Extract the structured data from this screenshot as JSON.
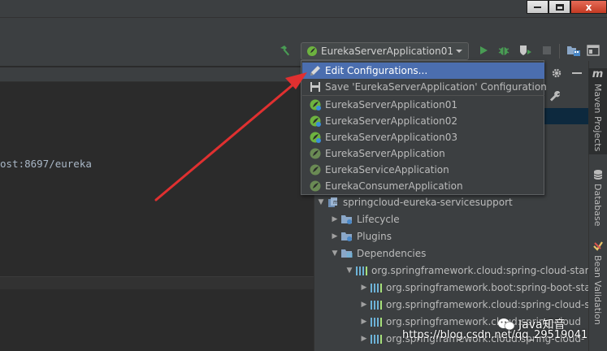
{
  "window": {
    "close_glyph": "x",
    "minimize_icon": "minimize-icon",
    "maximize_icon": "maximize-icon"
  },
  "toolbar": {
    "run_config": "EurekaServerApplication01",
    "icons": [
      "build-hammer-icon",
      "run-icon",
      "debug-icon",
      "coverage-icon",
      "stop-icon",
      "project-structure-icon",
      "layout-icon"
    ]
  },
  "editor": {
    "code_line": "ost:8697/eureka"
  },
  "dropdown": {
    "items": [
      {
        "label": "Edit Configurations...",
        "icon": "edit-pencil-icon",
        "selected": true
      },
      {
        "label": "Save 'EurekaServerApplication' Configuration",
        "icon": "save-icon",
        "selected": false
      },
      {
        "label": "EurekaServerApplication01",
        "icon": "spring-boot-icon",
        "selected": false
      },
      {
        "label": "EurekaServerApplication02",
        "icon": "spring-boot-icon",
        "selected": false
      },
      {
        "label": "EurekaServerApplication03",
        "icon": "spring-boot-icon",
        "selected": false
      },
      {
        "label": "EurekaServerApplication",
        "icon": "spring-boot-icon",
        "selected": false
      },
      {
        "label": "EurekaServiceApplication",
        "icon": "spring-boot-icon",
        "selected": false
      },
      {
        "label": "EurekaConsumerApplication",
        "icon": "spring-boot-icon",
        "selected": false
      }
    ]
  },
  "maven_tree": [
    {
      "label": "springcloud-eureka-servicesupport",
      "icon": "maven-module-icon",
      "expanded": true
    },
    {
      "label": "Lifecycle",
      "icon": "folder-gear-icon",
      "expanded": false
    },
    {
      "label": "Plugins",
      "icon": "folder-gear-icon",
      "expanded": false
    },
    {
      "label": "Dependencies",
      "icon": "dependencies-icon",
      "expanded": true
    },
    {
      "label": "org.springframework.cloud:spring-cloud-star",
      "icon": "library-icon",
      "expanded": true
    },
    {
      "label": "org.springframework.boot:spring-boot-sta",
      "icon": "library-icon",
      "expanded": false
    },
    {
      "label": "org.springframework.cloud:spring-cloud-s",
      "icon": "library-icon",
      "expanded": false
    },
    {
      "label": "org.springframework.cloud:spring-cloud",
      "icon": "library-icon",
      "expanded": false
    },
    {
      "label": "org.springframework.cloud:spring-cloud-",
      "icon": "library-icon",
      "expanded": false
    }
  ],
  "sidebar": {
    "maven_logo": "m",
    "maven_label": "Maven Projects",
    "database_label": "Database",
    "bean_label": "Bean Validation"
  },
  "watermark": {
    "brand": "Java知音",
    "url": "https://blog.csdn.net/qq_29519041"
  },
  "colors": {
    "accent": "#4b6eaf",
    "run_green": "#499c54",
    "arrow_red": "#e03030",
    "spring_green": "#6db33f"
  }
}
